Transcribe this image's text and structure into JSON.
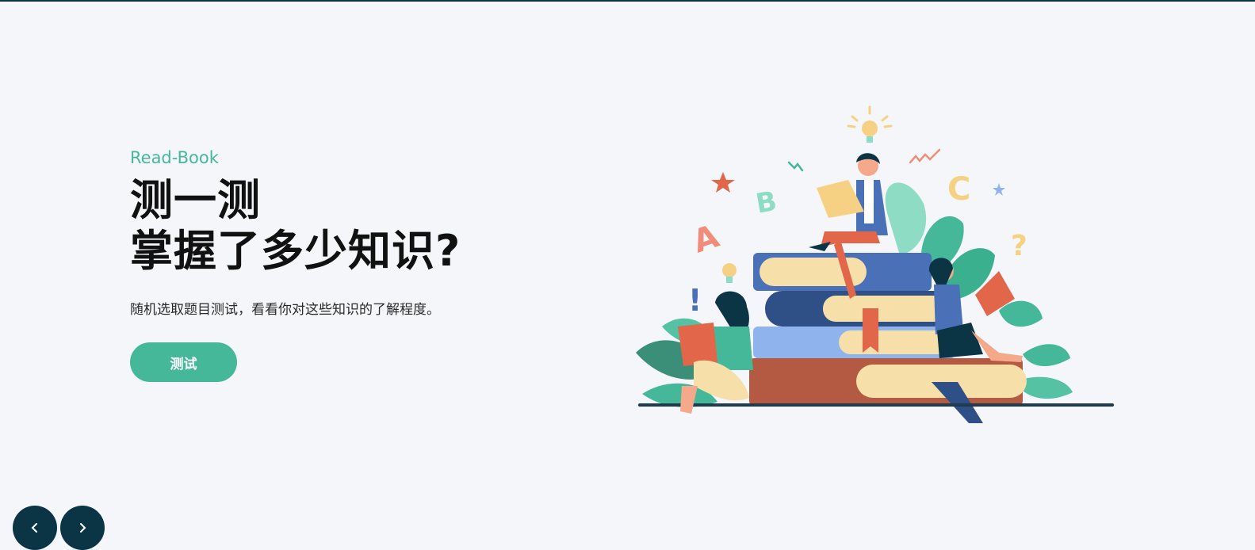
{
  "hero": {
    "eyebrow": "Read-Book",
    "title_line1": "测一测",
    "title_line2": "掌握了多少知识?",
    "description": "随机选取题目测试，看看你对这些知识的了解程度。",
    "cta_label": "测试"
  },
  "illustration": {
    "letters": [
      "A",
      "B",
      "C"
    ],
    "symbols": [
      "!",
      "?"
    ]
  },
  "carousel": {
    "prev_icon": "chevron-left-icon",
    "next_icon": "chevron-right-icon"
  },
  "colors": {
    "background": "#f4f6fa",
    "accent": "#46b89a",
    "dark": "#0b3444",
    "title": "#111111"
  }
}
